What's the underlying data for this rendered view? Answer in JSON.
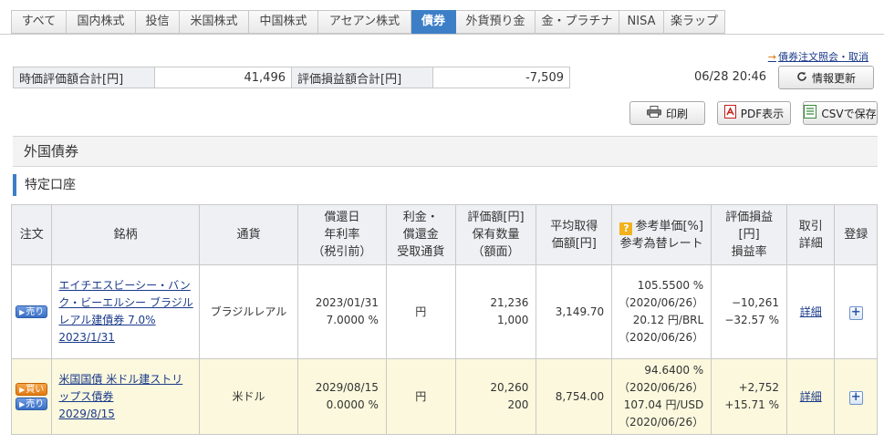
{
  "tabs": [
    "すべて",
    "国内株式",
    "投信",
    "米国株式",
    "中国株式",
    "アセアン株式",
    "債券",
    "外貨預り金",
    "金・プラチナ",
    "NISA",
    "楽ラップ"
  ],
  "active_tab": "債券",
  "order_link": "債券注文照会・取消",
  "summary": {
    "market_label": "時価評価額合計[円]",
    "market_value": "41,496",
    "pl_label": "評価損益額合計[円]",
    "pl_value": "-7,509"
  },
  "timestamp": "06/28 20:46",
  "buttons": {
    "refresh": "情報更新",
    "print": "印刷",
    "pdf": "PDF表示",
    "csv": "CSVで保存"
  },
  "section_title": "外国債券",
  "account_title": "特定口座",
  "headers": {
    "order": "注文",
    "name": "銘柄",
    "currency": "通貨",
    "redemption": [
      "償還日",
      "年利率",
      "（税引前）"
    ],
    "interest": [
      "利金・",
      "償還金",
      "受取通貨"
    ],
    "valuation": [
      "評価額[円]",
      "保有数量",
      "（額面）"
    ],
    "avg_price": [
      "平均取得",
      "価額[円]"
    ],
    "ref_price": [
      "参考単価[%]",
      "参考為替レート"
    ],
    "pl": [
      "評価損益",
      "[円]",
      "損益率"
    ],
    "detail": [
      "取引",
      "詳細"
    ],
    "register": "登録"
  },
  "rows": [
    {
      "badges": [
        "売り"
      ],
      "name": "エイチエスビーシー・バンク・ビーエルシー ブラジルレアル建債券 7.0%",
      "maturity": "2023/1/31",
      "currency": "ブラジルレアル",
      "redemption_date": "2023/01/31",
      "rate": "7.0000 %",
      "interest_currency": "円",
      "valuation": "21,236",
      "quantity": "1,000",
      "avg_price": "3,149.70",
      "ref_price": "105.5500 %",
      "ref_price_date": "（2020/06/26）",
      "fx_rate": "20.12 円/BRL",
      "fx_date": "（2020/06/26）",
      "pl": "−10,261",
      "pl_rate": "−32.57 %",
      "pl_color": "green",
      "detail": "詳細"
    },
    {
      "badges": [
        "買い",
        "売り"
      ],
      "name": "米国国債 米ドル建ストリップス債券",
      "maturity": "2029/8/15",
      "currency": "米ドル",
      "redemption_date": "2029/08/15",
      "rate": "0.0000 %",
      "interest_currency": "円",
      "valuation": "20,260",
      "quantity": "200",
      "avg_price": "8,754.00",
      "ref_price": "94.6400 %",
      "ref_price_date": "（2020/06/26）",
      "fx_rate": "107.04 円/USD",
      "fx_date": "（2020/06/26）",
      "pl": "+2,752",
      "pl_rate": "+15.71 %",
      "pl_color": "red",
      "detail": "詳細"
    }
  ]
}
